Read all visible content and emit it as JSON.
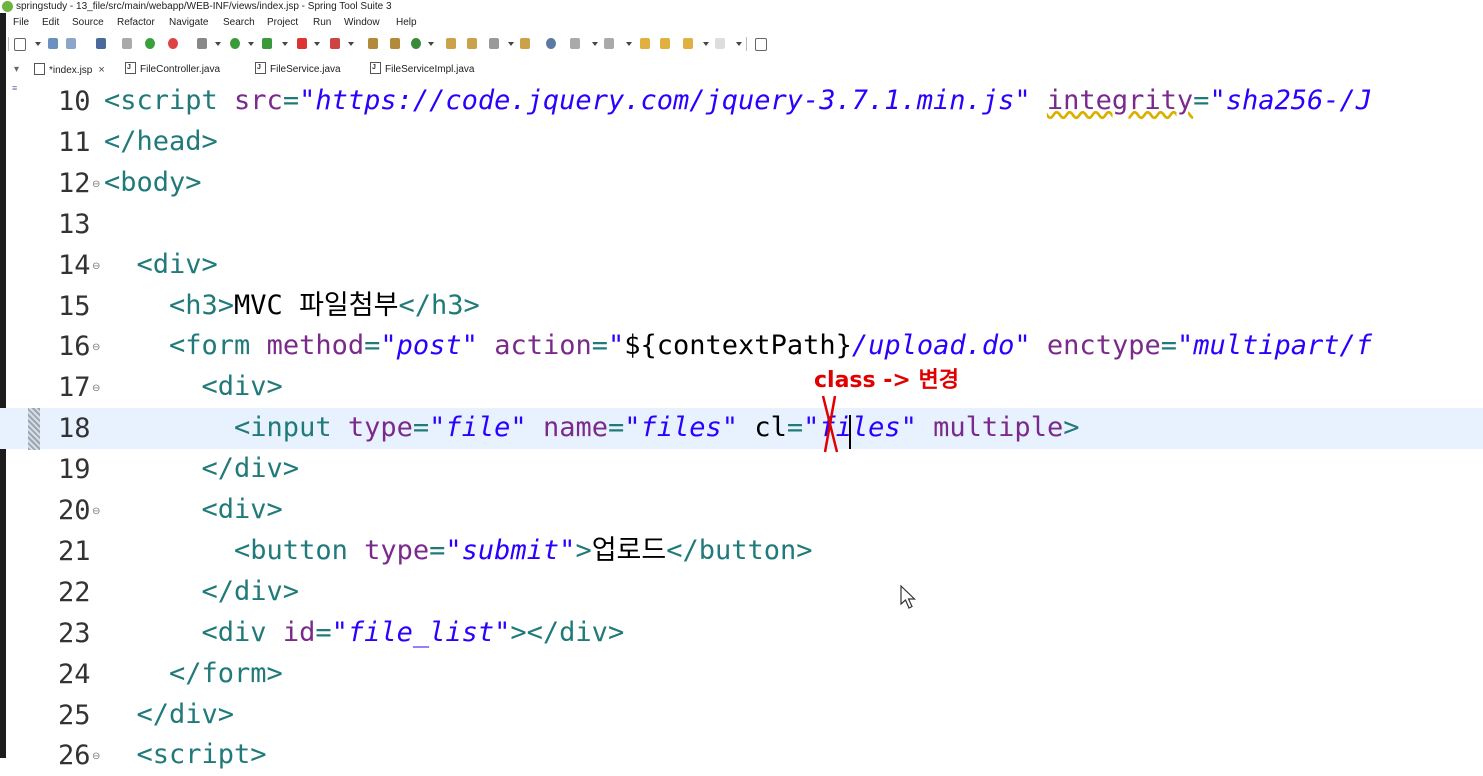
{
  "window": {
    "title": "springstudy - 13_file/src/main/webapp/WEB-INF/views/index.jsp - Spring Tool Suite 3"
  },
  "menubar": [
    "File",
    "Edit",
    "Source",
    "Refactor",
    "Navigate",
    "Search",
    "Project",
    "Run",
    "Window",
    "Help"
  ],
  "tabs": [
    {
      "label": "*index.jsp",
      "active": true,
      "closable": true,
      "icon": "jsp-file-icon"
    },
    {
      "label": "FileController.java",
      "active": false,
      "icon": "java-file-icon"
    },
    {
      "label": "FileService.java",
      "active": false,
      "icon": "java-file-icon"
    },
    {
      "label": "FileServiceImpl.java",
      "active": false,
      "icon": "java-file-icon"
    }
  ],
  "editor": {
    "current_line": "18",
    "lines": [
      {
        "num": "10",
        "fold": "",
        "parts": [
          [
            "tag",
            "<script "
          ],
          [
            "att",
            "src"
          ],
          [
            "tag",
            "="
          ],
          [
            "val",
            "\"https://code.jquery.com/jquery-3.7.1.min.js\""
          ],
          [
            "tag",
            " "
          ],
          [
            "att",
            "integrity"
          ],
          [
            "tag",
            "="
          ],
          [
            "val",
            "\"sha256-/J"
          ]
        ]
      },
      {
        "num": "11",
        "fold": "",
        "parts": [
          [
            "tag",
            "</head>"
          ]
        ]
      },
      {
        "num": "12",
        "fold": "⊖",
        "parts": [
          [
            "tag",
            "<body>"
          ]
        ]
      },
      {
        "num": "13",
        "fold": "",
        "parts": []
      },
      {
        "num": "14",
        "fold": "⊖",
        "parts": [
          [
            "tag",
            "  <div>"
          ]
        ]
      },
      {
        "num": "15",
        "fold": "",
        "parts": [
          [
            "tag",
            "    <h3>"
          ],
          [
            "txt",
            "MVC 파일첨부"
          ],
          [
            "tag",
            "</h3>"
          ]
        ]
      },
      {
        "num": "16",
        "fold": "⊖",
        "parts": [
          [
            "tag",
            "    <form "
          ],
          [
            "att",
            "method"
          ],
          [
            "tag",
            "="
          ],
          [
            "val",
            "\"post\""
          ],
          [
            "tag",
            " "
          ],
          [
            "att",
            "action"
          ],
          [
            "tag",
            "="
          ],
          [
            "val",
            "\""
          ],
          [
            "txt",
            "${contextPath}"
          ],
          [
            "val",
            "/upload.do\""
          ],
          [
            "tag",
            " "
          ],
          [
            "att",
            "enctype"
          ],
          [
            "tag",
            "="
          ],
          [
            "val",
            "\"multipart/f"
          ]
        ]
      },
      {
        "num": "17",
        "fold": "⊖",
        "parts": [
          [
            "tag",
            "      <div>"
          ]
        ]
      },
      {
        "num": "18",
        "fold": "",
        "parts": [
          [
            "tag",
            "        <input "
          ],
          [
            "att",
            "type"
          ],
          [
            "tag",
            "="
          ],
          [
            "val",
            "\"file\""
          ],
          [
            "tag",
            " "
          ],
          [
            "att",
            "name"
          ],
          [
            "tag",
            "="
          ],
          [
            "val",
            "\"files\""
          ],
          [
            "tag",
            " "
          ],
          [
            "txt",
            "cl"
          ],
          [
            "tag",
            "="
          ],
          [
            "val",
            "\"files\""
          ],
          [
            "tag",
            " "
          ],
          [
            "att",
            "multiple"
          ],
          [
            "tag",
            ">"
          ]
        ]
      },
      {
        "num": "19",
        "fold": "",
        "parts": [
          [
            "tag",
            "      </div>"
          ]
        ]
      },
      {
        "num": "20",
        "fold": "⊖",
        "parts": [
          [
            "tag",
            "      <div>"
          ]
        ]
      },
      {
        "num": "21",
        "fold": "",
        "parts": [
          [
            "tag",
            "        <button "
          ],
          [
            "att",
            "type"
          ],
          [
            "tag",
            "="
          ],
          [
            "val",
            "\"submit\""
          ],
          [
            "tag",
            ">"
          ],
          [
            "txt",
            "업로드"
          ],
          [
            "tag",
            "</button>"
          ]
        ]
      },
      {
        "num": "22",
        "fold": "",
        "parts": [
          [
            "tag",
            "      </div>"
          ]
        ]
      },
      {
        "num": "23",
        "fold": "",
        "parts": [
          [
            "tag",
            "      <div "
          ],
          [
            "att",
            "id"
          ],
          [
            "tag",
            "="
          ],
          [
            "val",
            "\"file_list\""
          ],
          [
            "tag",
            "></div>"
          ]
        ]
      },
      {
        "num": "24",
        "fold": "",
        "parts": [
          [
            "tag",
            "    </form>"
          ]
        ]
      },
      {
        "num": "25",
        "fold": "",
        "parts": [
          [
            "tag",
            "  </div>"
          ]
        ]
      },
      {
        "num": "26",
        "fold": "⊖",
        "parts": [
          [
            "tag",
            "  <script>"
          ]
        ]
      }
    ]
  },
  "annotation": {
    "text": "class -> 변경",
    "color": "#e00000"
  },
  "colors": {
    "tag": "#217a7a",
    "attribute": "#7a2a8a",
    "value": "#2a00ff",
    "current_line": "#e8f2fe"
  }
}
